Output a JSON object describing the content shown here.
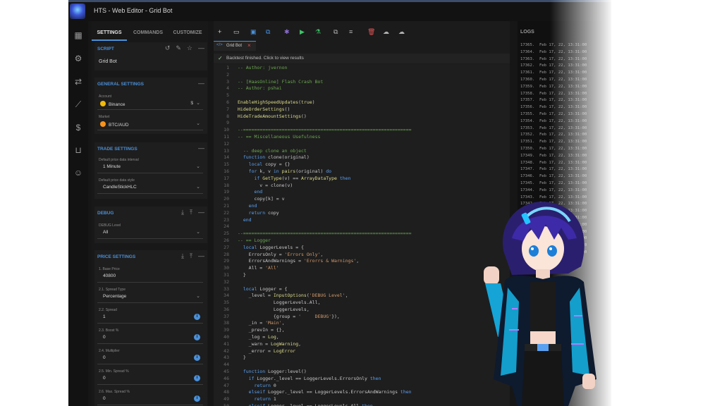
{
  "window": {
    "title": "HTS - Web Editor - Grid Bot"
  },
  "rail_icons": [
    "dashboard-icon",
    "bot-icon",
    "exchange-icon",
    "chart-icon",
    "dollar-icon",
    "cart-icon",
    "user-icon"
  ],
  "settings": {
    "tabs": [
      "SETTINGS",
      "COMMANDS",
      "CUSTOMIZE"
    ],
    "script": {
      "title": "SCRIPT",
      "name": "Grid Bot"
    },
    "general": {
      "title": "GENERAL SETTINGS",
      "account_label": "Account",
      "account_value": "Binance",
      "market_label": "Market",
      "market_value": "BTC/AUD",
      "currency_symbol": "$"
    },
    "trade": {
      "title": "TRADE SETTINGS",
      "interval_label": "Default price data interval",
      "interval_value": "1 Minute",
      "style_label": "Default price data style",
      "style_value": "CandleStickHLC"
    },
    "debug": {
      "title": "DEBUG",
      "level_label": "DEBUG Level",
      "level_value": "All"
    },
    "price": {
      "title": "PRICE SETTINGS",
      "fields": [
        {
          "label": "1. Base Price",
          "value": "40800"
        },
        {
          "label": "2.1. Spread Type",
          "value": "Percentage"
        },
        {
          "label": "2.2. Spread",
          "value": "1"
        },
        {
          "label": "2.3. Boost %",
          "value": "0"
        },
        {
          "label": "2.4. Multiplier",
          "value": "0"
        },
        {
          "label": "2.5. Min. Spread %",
          "value": "0"
        },
        {
          "label": "2.6. Max. Spread %",
          "value": "0"
        }
      ]
    }
  },
  "editor": {
    "file_tab": "Grid Bot",
    "status": "Backtest finished. Click to view results",
    "lines": [
      "-- Author: jvernon",
      "",
      "-- [HaasOnline] Flash Crash Bot",
      "-- Author: pshai",
      "",
      "EnableHighSpeedUpdates(true)",
      "HideOrderSettings()",
      "HideTradeAmountSettings()",
      "",
      "--=============================================================",
      "-- == Miscellaneous Usefulness",
      "",
      "  -- deep clone an object",
      "  function clone(original)",
      "    local copy = {}",
      "    for k, v in pairs(original) do",
      "      if GetType(v) == ArrayDataType then",
      "        v = clone(v)",
      "      end",
      "      copy[k] = v",
      "    end",
      "    return copy",
      "  end",
      "",
      "--=============================================================",
      "-- == Logger",
      "  local LoggerLevels = {",
      "    ErrorsOnly = 'Errors Only',",
      "    ErrorsAndWarnings = 'Erorrs & Warnings',",
      "    All = 'All'",
      "  }",
      "",
      "  local Logger = {",
      "    _level = InputOptions('DEBUG Level',",
      "             LoggerLevels.All,",
      "             LoggerLevels,",
      "             {group = '     DEBUG'}),",
      "    _in = 'Main',",
      "    _prevIn = {},",
      "    _log = Log,",
      "    _warn = LogWarning,",
      "    _error = LogError",
      "  }",
      "",
      "  function Logger:level()",
      "    if Logger._level == LoggerLevels.ErrorsOnly then",
      "      return 0",
      "    elseif Logger._level == LoggerLevels.ErrorsAndWarnings then",
      "      return 1",
      "    elseif Logger._level == LoggerLevels.All then"
    ]
  },
  "logs": {
    "title": "LOGS",
    "lines": [
      "17365.  Feb 17, 22, 13:31:00",
      "17364.  Feb 17, 22, 13:31:00",
      "17363.  Feb 17, 22, 13:31:00",
      "17362.  Feb 17, 22, 13:31:00",
      "17361.  Feb 17, 22, 13:31:00",
      "17360.  Feb 17, 22, 13:31:00",
      "17359.  Feb 17, 22, 13:31:00",
      "17358.  Feb 17, 22, 13:31:00",
      "17357.  Feb 17, 22, 13:31:00",
      "17356.  Feb 17, 22, 13:31:00",
      "17355.  Feb 17, 22, 13:31:00",
      "17354.  Feb 17, 22, 13:31:00",
      "17353.  Feb 17, 22, 13:31:00",
      "17352.  Feb 17, 22, 13:31:00",
      "17351.  Feb 17, 22, 13:31:00",
      "17350.  Feb 17, 22, 13:31:00",
      "17349.  Feb 17, 22, 13:31:00",
      "17348.  Feb 17, 22, 13:31:00",
      "17347.  Feb 17, 22, 13:31:00",
      "17346.  Feb 17, 22, 13:31:00",
      "17345.  Feb 17, 22, 13:31:00",
      "17344.  Feb 17, 22, 13:31:00",
      "17343.  Feb 17, 22, 13:31:00",
      "17342.  Feb 17, 22, 13:31:00",
      "17341.  Feb 17, 22, 13:31:00",
      "17340.  Feb 17, 22, 13:31:00",
      "17339.  Feb 17, 22, 13:31:00",
      "17338.  Feb 17, 22, 13:31:00",
      "17337.  Feb 17, 22, 13:31:00",
      "17336.  Feb 17, 22, 13:31:00",
      "17335.  Feb 17, 22, 13:31:00"
    ]
  },
  "colors": {
    "accent": "#4a90d9",
    "comment": "#6aa84f",
    "keyword": "#5aa0f0",
    "string": "#d49a6a",
    "delete": "#e05555",
    "run": "#3ec26b"
  }
}
